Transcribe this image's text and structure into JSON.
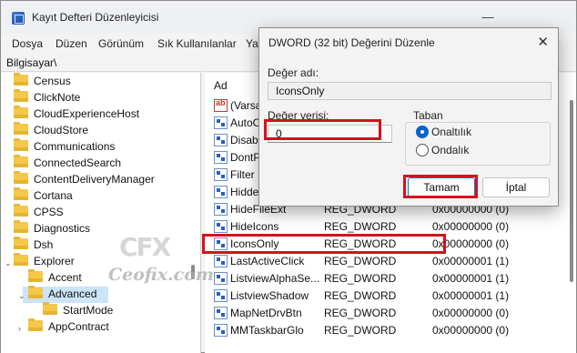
{
  "window": {
    "title": "Kayıt Defteri Düzenleyicisi",
    "minimize": "—",
    "maximize": "☐",
    "close": "✕"
  },
  "menu": [
    "Dosya",
    "Düzen",
    "Görünüm",
    "Sık Kullanılanlar",
    "Yar"
  ],
  "address": "Bilgisayar\\",
  "tree": {
    "items": [
      "Census",
      "ClickNote",
      "CloudExperienceHost",
      "CloudStore",
      "Communications",
      "ConnectedSearch",
      "ContentDeliveryManager",
      "Cortana",
      "CPSS",
      "Diagnostics",
      "Dsh",
      "Explorer",
      "Accent",
      "Advanced",
      "StartMode",
      "AppContract"
    ],
    "selected": "Advanced"
  },
  "list": {
    "column_name": "Ad",
    "rows": [
      {
        "name": "(Varsay",
        "type": "",
        "value": ""
      },
      {
        "name": "AutoC",
        "type": "",
        "value": ""
      },
      {
        "name": "Disabl",
        "type": "",
        "value": ""
      },
      {
        "name": "DontP",
        "type": "",
        "value": ""
      },
      {
        "name": "Filter",
        "type": "",
        "value": ""
      },
      {
        "name": "Hidde",
        "type": "",
        "value": ""
      },
      {
        "name": "HideFileExt",
        "type": "REG_DWORD",
        "value": "0x00000000 (0)"
      },
      {
        "name": "HideIcons",
        "type": "REG_DWORD",
        "value": "0x00000000 (0)"
      },
      {
        "name": "IconsOnly",
        "type": "REG_DWORD",
        "value": "0x00000000 (0)"
      },
      {
        "name": "LastActiveClick",
        "type": "REG_DWORD",
        "value": "0x00000001 (1)"
      },
      {
        "name": "ListviewAlphaSe...",
        "type": "REG_DWORD",
        "value": "0x00000001 (1)"
      },
      {
        "name": "ListviewShadow",
        "type": "REG_DWORD",
        "value": "0x00000001 (1)"
      },
      {
        "name": "MapNetDrvBtn",
        "type": "REG_DWORD",
        "value": "0x00000000 (0)"
      },
      {
        "name": "MMTaskbarGlo",
        "type": "REG_DWORD",
        "value": "0x00000000 (0)"
      }
    ]
  },
  "watermark": {
    "logo": "CFX",
    "text": "Ceofix.com"
  },
  "dialog": {
    "title": "DWORD (32 bit) Değerini Düzenle",
    "close": "✕",
    "value_name_label": "Değer adı:",
    "value_name": "IconsOnly",
    "value_data_label": "Değer verisi:",
    "value_data": "0",
    "base_label": "Taban",
    "base_options": [
      "Onaltılık",
      "Ondalık"
    ],
    "base_selected": "Onaltılık",
    "ok_label": "Tamam",
    "cancel_label": "İptal"
  },
  "colors": {
    "highlight": "#d4121a",
    "selection": "#cce4f7",
    "accent": "#0a64c8"
  }
}
